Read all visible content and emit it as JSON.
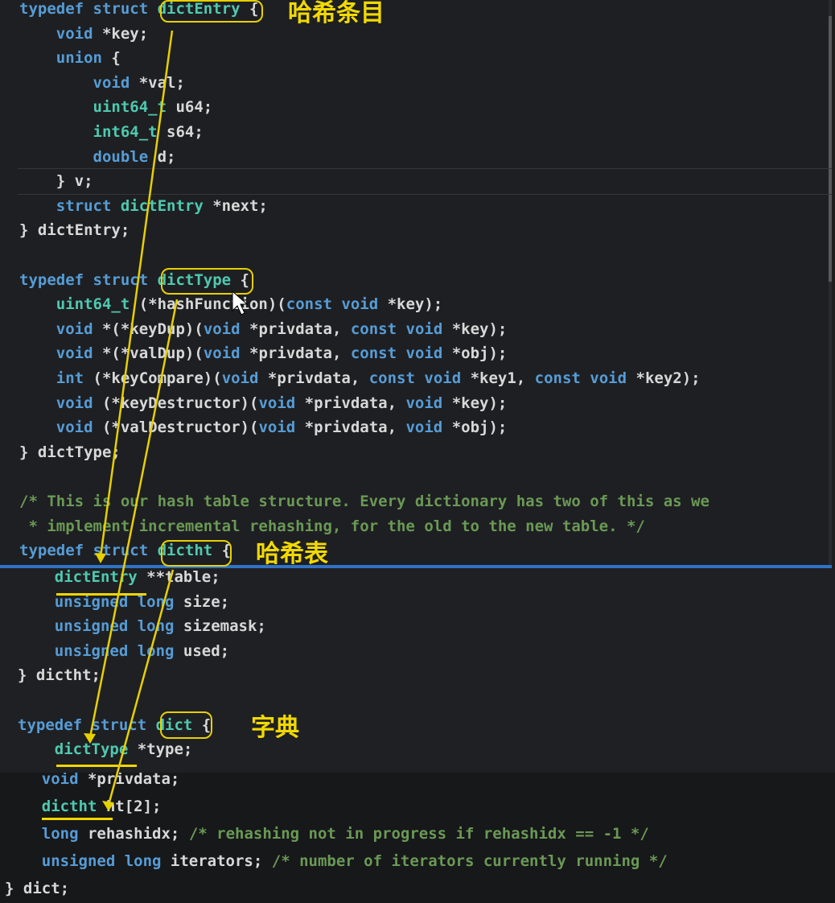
{
  "code_top": [
    {
      "parts": [
        [
          "kw",
          "typedef "
        ],
        [
          "kw",
          "struct "
        ],
        [
          "ty",
          "dictEntry"
        ],
        [
          "pl",
          " {"
        ]
      ]
    },
    {
      "parts": [
        [
          "pl",
          "    "
        ],
        [
          "kw",
          "void"
        ],
        [
          "pl",
          " *key;"
        ]
      ]
    },
    {
      "parts": [
        [
          "pl",
          "    "
        ],
        [
          "kw",
          "union"
        ],
        [
          "pl",
          " {"
        ]
      ]
    },
    {
      "parts": [
        [
          "pl",
          "        "
        ],
        [
          "kw",
          "void"
        ],
        [
          "pl",
          " *val;"
        ]
      ]
    },
    {
      "parts": [
        [
          "pl",
          "        "
        ],
        [
          "ty",
          "uint64_t"
        ],
        [
          "pl",
          " u64;"
        ]
      ]
    },
    {
      "parts": [
        [
          "pl",
          "        "
        ],
        [
          "ty",
          "int64_t"
        ],
        [
          "pl",
          " s64;"
        ]
      ]
    },
    {
      "parts": [
        [
          "pl",
          "        "
        ],
        [
          "kw",
          "double"
        ],
        [
          "pl",
          " d;"
        ]
      ]
    },
    {
      "parts": [
        [
          "pl",
          "    } v;"
        ]
      ]
    },
    {
      "parts": [
        [
          "pl",
          "    "
        ],
        [
          "kw",
          "struct "
        ],
        [
          "ty",
          "dictEntry"
        ],
        [
          "pl",
          " *next;"
        ]
      ]
    },
    {
      "parts": [
        [
          "pl",
          "} dictEntry;"
        ]
      ]
    },
    {
      "parts": [
        [
          "pl",
          ""
        ]
      ]
    },
    {
      "parts": [
        [
          "kw",
          "typedef "
        ],
        [
          "kw",
          "struct "
        ],
        [
          "ty",
          "dictType"
        ],
        [
          "pl",
          " {"
        ]
      ]
    },
    {
      "parts": [
        [
          "pl",
          "    "
        ],
        [
          "ty",
          "uint64_t"
        ],
        [
          "pl",
          " (*hashFunction)("
        ],
        [
          "kw",
          "const "
        ],
        [
          "kw",
          "void"
        ],
        [
          "pl",
          " *key);"
        ]
      ]
    },
    {
      "parts": [
        [
          "pl",
          "    "
        ],
        [
          "kw",
          "void"
        ],
        [
          "pl",
          " *(*keyDup)("
        ],
        [
          "kw",
          "void"
        ],
        [
          "pl",
          " *privdata, "
        ],
        [
          "kw",
          "const "
        ],
        [
          "kw",
          "void"
        ],
        [
          "pl",
          " *key);"
        ]
      ]
    },
    {
      "parts": [
        [
          "pl",
          "    "
        ],
        [
          "kw",
          "void"
        ],
        [
          "pl",
          " *(*valDup)("
        ],
        [
          "kw",
          "void"
        ],
        [
          "pl",
          " *privdata, "
        ],
        [
          "kw",
          "const "
        ],
        [
          "kw",
          "void"
        ],
        [
          "pl",
          " *obj);"
        ]
      ]
    },
    {
      "parts": [
        [
          "pl",
          "    "
        ],
        [
          "kw",
          "int"
        ],
        [
          "pl",
          " (*keyCompare)("
        ],
        [
          "kw",
          "void"
        ],
        [
          "pl",
          " *privdata, "
        ],
        [
          "kw",
          "const "
        ],
        [
          "kw",
          "void"
        ],
        [
          "pl",
          " *key1, "
        ],
        [
          "kw",
          "const "
        ],
        [
          "kw",
          "void"
        ],
        [
          "pl",
          " *key2);"
        ]
      ]
    },
    {
      "parts": [
        [
          "pl",
          "    "
        ],
        [
          "kw",
          "void"
        ],
        [
          "pl",
          " (*keyDestructor)("
        ],
        [
          "kw",
          "void"
        ],
        [
          "pl",
          " *privdata, "
        ],
        [
          "kw",
          "void"
        ],
        [
          "pl",
          " *key);"
        ]
      ]
    },
    {
      "parts": [
        [
          "pl",
          "    "
        ],
        [
          "kw",
          "void"
        ],
        [
          "pl",
          " (*valDestructor)("
        ],
        [
          "kw",
          "void"
        ],
        [
          "pl",
          " *privdata, "
        ],
        [
          "kw",
          "void"
        ],
        [
          "pl",
          " *obj);"
        ]
      ]
    },
    {
      "parts": [
        [
          "pl",
          "} dictType;"
        ]
      ]
    },
    {
      "parts": [
        [
          "pl",
          ""
        ]
      ]
    },
    {
      "parts": [
        [
          "cm",
          "/* This is our hash table structure. Every dictionary has two of this as we"
        ]
      ]
    },
    {
      "parts": [
        [
          "cm",
          " * implement incremental rehashing, for the old to the new table. */"
        ]
      ]
    },
    {
      "parts": [
        [
          "kw",
          "typedef "
        ],
        [
          "kw",
          "struct "
        ],
        [
          "ty",
          "dictht"
        ],
        [
          "pl",
          " {"
        ]
      ]
    }
  ],
  "code_mid": [
    {
      "parts": [
        [
          "pl",
          "    "
        ],
        [
          "ty",
          "dictEntry"
        ],
        [
          "pl",
          " **table;"
        ]
      ]
    },
    {
      "parts": [
        [
          "pl",
          "    "
        ],
        [
          "kw",
          "unsigned "
        ],
        [
          "kw",
          "long"
        ],
        [
          "pl",
          " size;"
        ]
      ]
    },
    {
      "parts": [
        [
          "pl",
          "    "
        ],
        [
          "kw",
          "unsigned "
        ],
        [
          "kw",
          "long"
        ],
        [
          "pl",
          " sizemask;"
        ]
      ]
    },
    {
      "parts": [
        [
          "pl",
          "    "
        ],
        [
          "kw",
          "unsigned "
        ],
        [
          "kw",
          "long"
        ],
        [
          "pl",
          " used;"
        ]
      ]
    },
    {
      "parts": [
        [
          "pl",
          "} dictht;"
        ]
      ]
    },
    {
      "parts": [
        [
          "pl",
          ""
        ]
      ]
    },
    {
      "parts": [
        [
          "kw",
          "typedef "
        ],
        [
          "kw",
          "struct "
        ],
        [
          "ty",
          "dict"
        ],
        [
          "pl",
          " {"
        ]
      ]
    },
    {
      "parts": [
        [
          "pl",
          "    "
        ],
        [
          "ty",
          "dictType"
        ],
        [
          "pl",
          " *type;"
        ]
      ]
    }
  ],
  "code_bottom": [
    {
      "parts": [
        [
          "pl",
          "    "
        ],
        [
          "kw",
          "void"
        ],
        [
          "pl",
          " *privdata;"
        ]
      ]
    },
    {
      "parts": [
        [
          "pl",
          "    "
        ],
        [
          "ty",
          "dictht"
        ],
        [
          "pl",
          " ht[2];"
        ]
      ]
    },
    {
      "parts": [
        [
          "pl",
          "    "
        ],
        [
          "kw",
          "long"
        ],
        [
          "pl",
          " rehashidx; "
        ],
        [
          "cm",
          "/* rehashing not in progress if rehashidx == -1 */"
        ]
      ]
    },
    {
      "parts": [
        [
          "pl",
          "    "
        ],
        [
          "kw",
          "unsigned "
        ],
        [
          "kw",
          "long"
        ],
        [
          "pl",
          " iterators; "
        ],
        [
          "cm",
          "/* number of iterators currently running */"
        ]
      ]
    },
    {
      "parts": [
        [
          "pl",
          "} dict;"
        ]
      ]
    }
  ],
  "annotations": {
    "dictEntry_label": "哈希条目",
    "dictht_label": "哈希表",
    "dict_label": "字典"
  },
  "colors": {
    "keyword": "#569cd6",
    "type": "#4ec9b0",
    "comment": "#6a9955",
    "annotation": "#f1d900"
  }
}
